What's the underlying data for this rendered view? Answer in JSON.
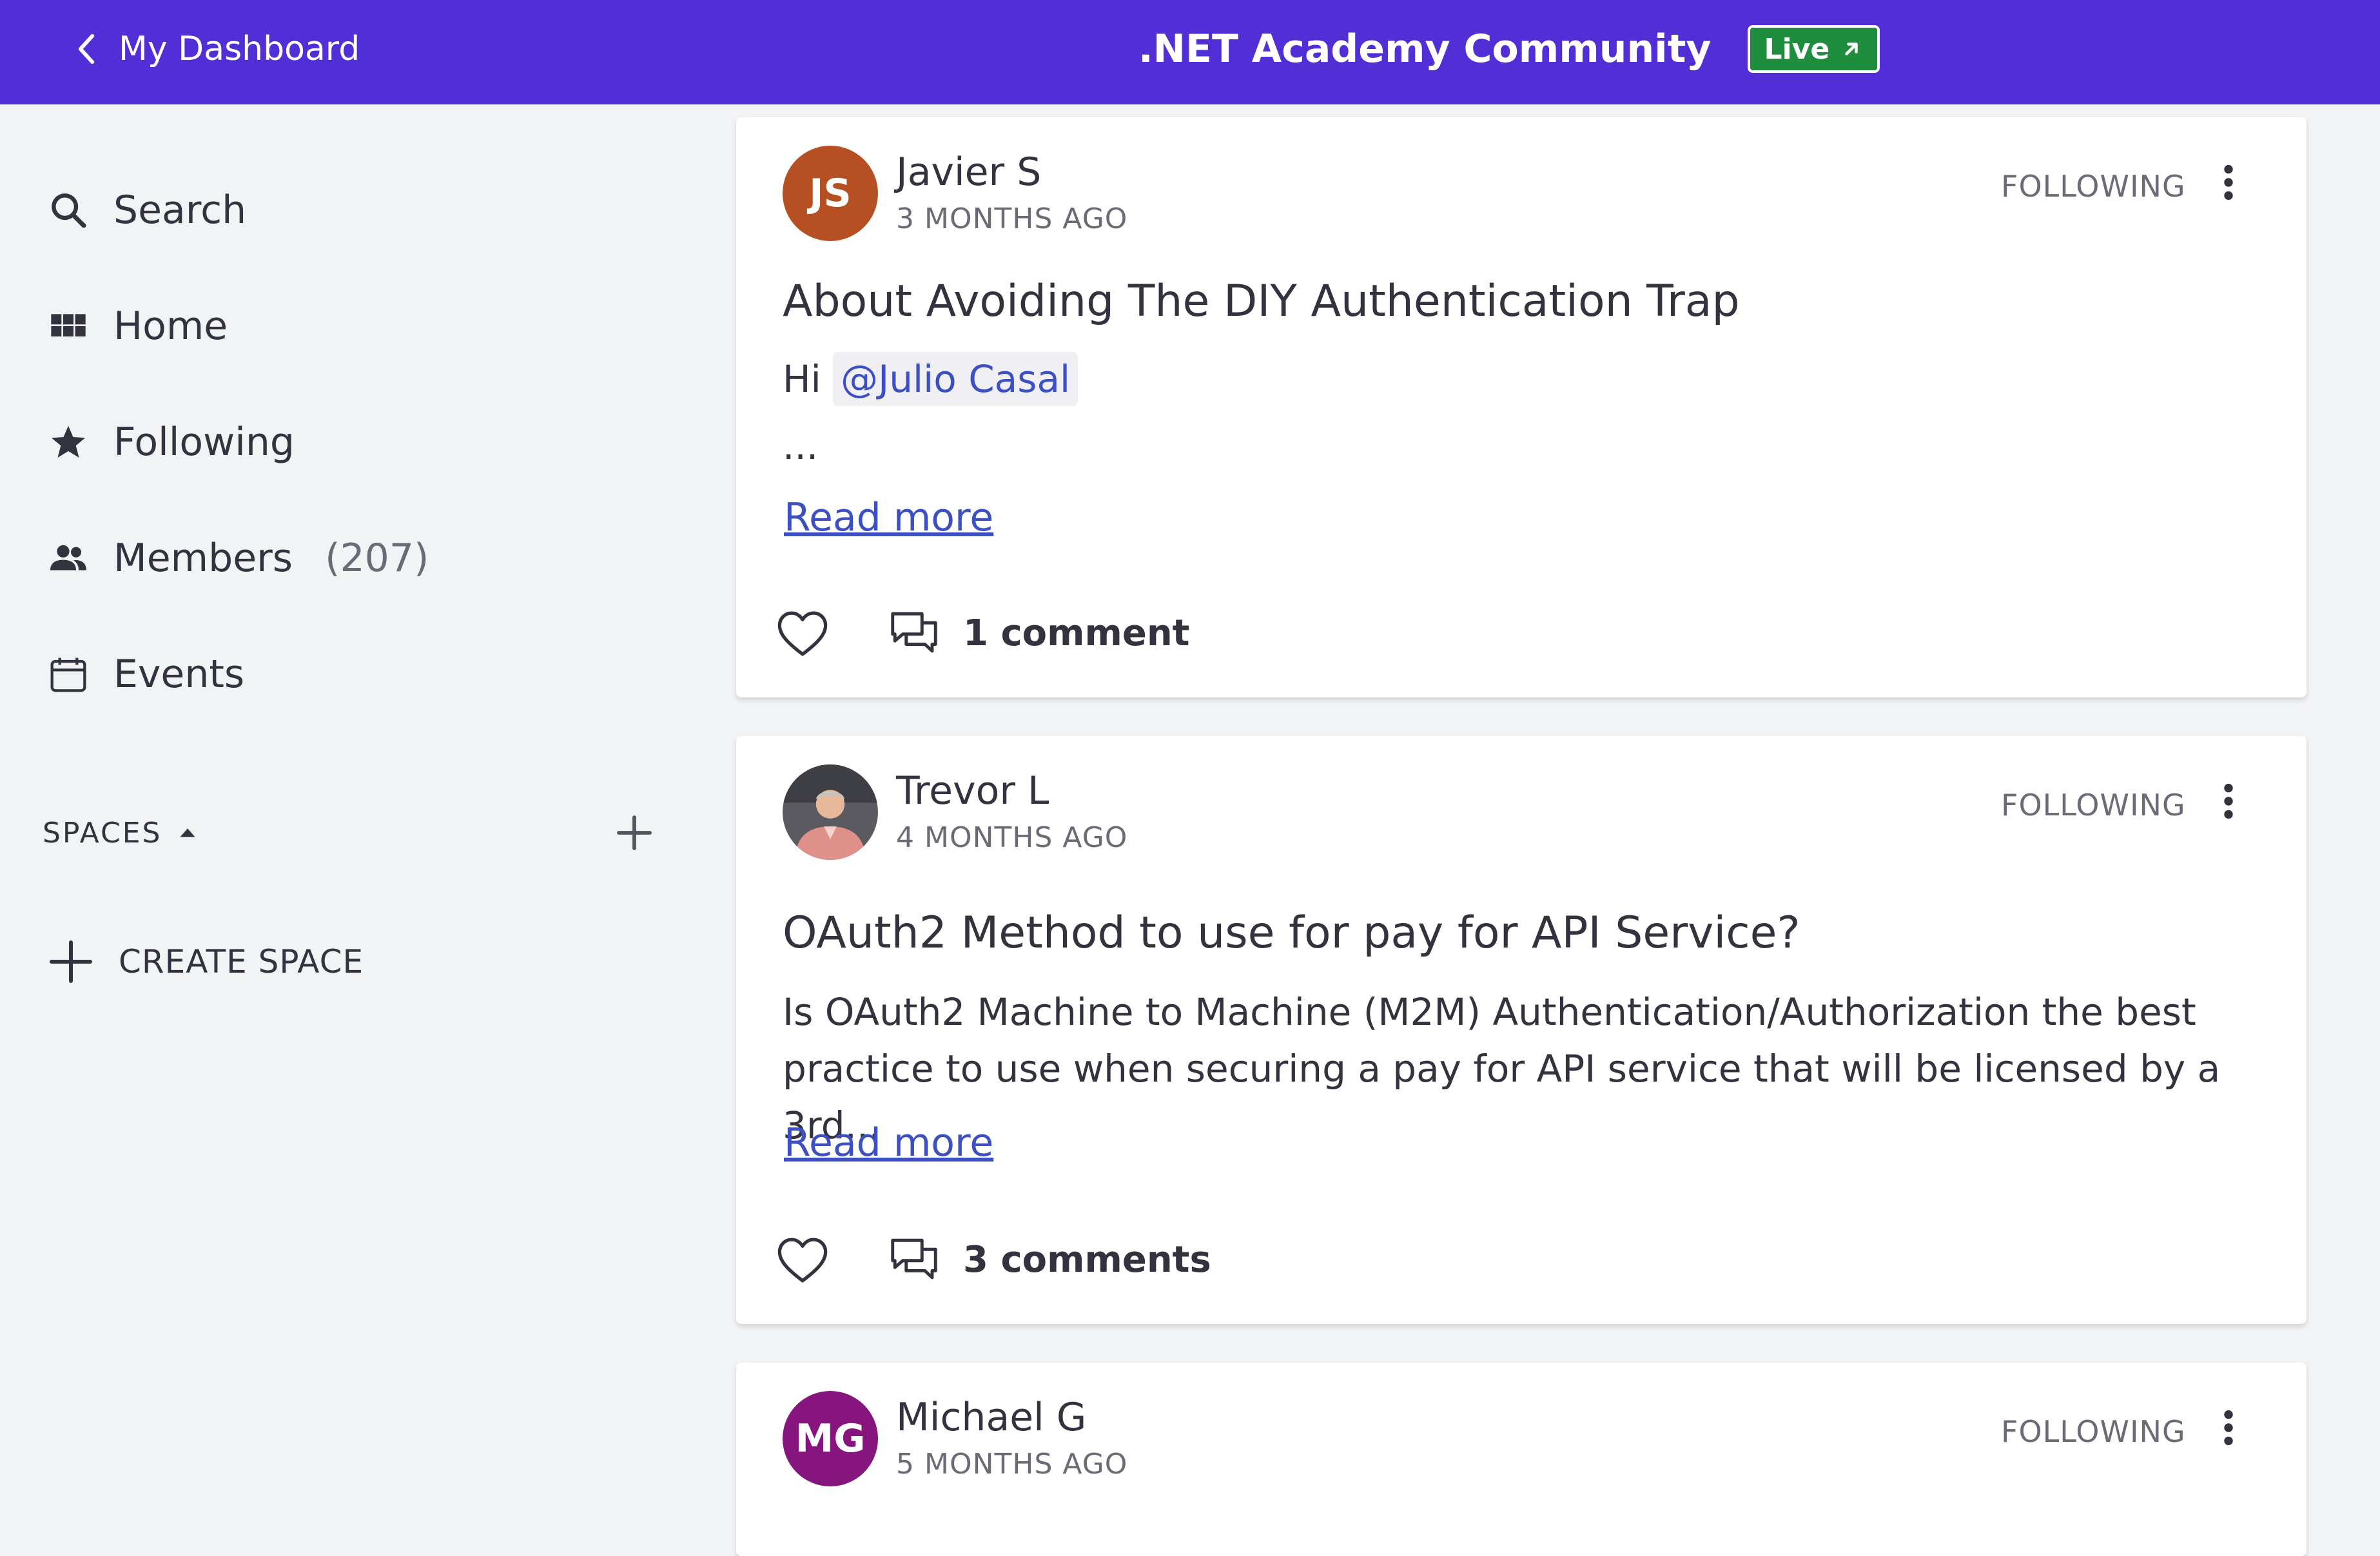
{
  "topbar": {
    "back_label": "My Dashboard",
    "title": ".NET Academy Community",
    "live_label": "Live"
  },
  "sidebar": {
    "items": [
      {
        "label": "Search",
        "icon": "search-icon"
      },
      {
        "label": "Home",
        "icon": "grid-icon"
      },
      {
        "label": "Following",
        "icon": "star-icon"
      },
      {
        "label": "Members",
        "count": "(207)",
        "icon": "people-icon"
      },
      {
        "label": "Events",
        "icon": "calendar-icon"
      }
    ],
    "spaces_label": "SPACES",
    "create_space_label": "CREATE SPACE"
  },
  "posts": [
    {
      "initials": "JS",
      "avatar_color": "#b64f21",
      "author": "Javier S",
      "time": "3 MONTHS AGO",
      "follow": "FOLLOWING",
      "title": "About Avoiding The DIY Authentication Trap",
      "greeting": "Hi",
      "mention": "@Julio Casal",
      "ellipsis": "...",
      "read_more": "Read more",
      "comments": "1 comment"
    },
    {
      "initials": "",
      "author": "Trevor L",
      "time": "4 MONTHS AGO",
      "follow": "FOLLOWING",
      "title": "OAuth2 Method to use for pay for API Service?",
      "excerpt": "Is OAuth2 Machine to Machine (M2M) Authentication/Authorization the best practice to use when securing a pay for API service that will be licensed by a 3rd...",
      "read_more": "Read more",
      "comments": "3 comments"
    },
    {
      "initials": "MG",
      "avatar_color": "#86157e",
      "author": "Michael G",
      "time": "5 MONTHS AGO",
      "follow": "FOLLOWING"
    }
  ],
  "colors": {
    "brand": "#522ed6",
    "live_badge": "#1e8e3e",
    "link": "#3d50c3"
  }
}
